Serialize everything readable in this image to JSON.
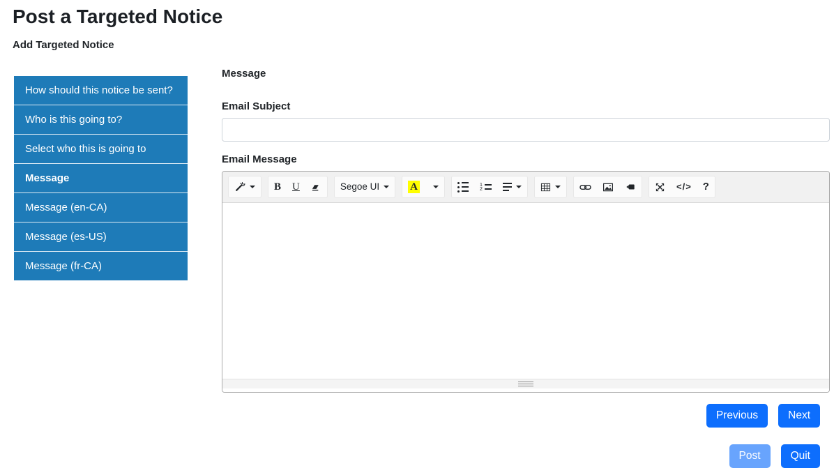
{
  "page": {
    "title": "Post a Targeted Notice",
    "subtitle": "Add Targeted Notice"
  },
  "wizard": {
    "steps": [
      {
        "label": "How should this notice be sent?",
        "active": false
      },
      {
        "label": "Who is this going to?",
        "active": false
      },
      {
        "label": "Select who this is going to",
        "active": false
      },
      {
        "label": "Message",
        "active": true
      },
      {
        "label": "Message (en-CA)",
        "active": false
      },
      {
        "label": "Message (es-US)",
        "active": false
      },
      {
        "label": "Message (fr-CA)",
        "active": false
      }
    ]
  },
  "form": {
    "section_heading": "Message",
    "email_subject_label": "Email Subject",
    "email_subject_value": "",
    "email_message_label": "Email Message",
    "email_message_value": ""
  },
  "editor": {
    "font_name": "Segoe UI",
    "bold_label": "B",
    "underline_label": "U",
    "color_letter": "A",
    "codeview_label": "</>",
    "help_label": "?",
    "ol_num_1": "1",
    "ol_num_2": "2",
    "color_highlight": "#ffff00"
  },
  "actions": {
    "previous_label": "Previous",
    "next_label": "Next",
    "post_label": "Post",
    "quit_label": "Quit"
  },
  "colors": {
    "sidebar_blue": "#1e7bb8",
    "primary_button_blue": "#0d6efd",
    "toolbar_background": "#f1f1f1",
    "editor_border": "#a9a9a9"
  }
}
